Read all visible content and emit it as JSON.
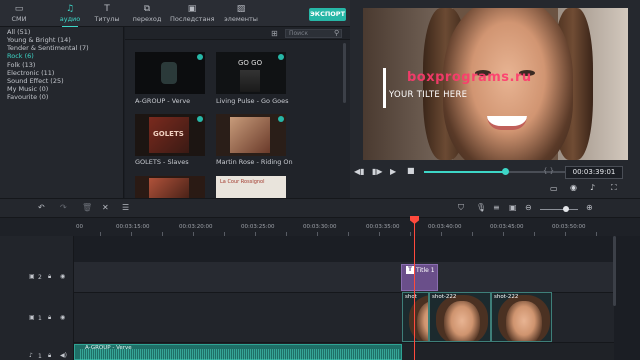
{
  "top_tabs": [
    {
      "label": "СМИ",
      "icon": "folder-icon"
    },
    {
      "label": "аудио",
      "icon": "music-note-icon",
      "active": true
    },
    {
      "label": "Титулы",
      "icon": "text-icon"
    },
    {
      "label": "переход",
      "icon": "transition-icon"
    },
    {
      "label": "Последстаня",
      "icon": "effects-icon"
    },
    {
      "label": "элементы",
      "icon": "image-icon"
    }
  ],
  "export_label": "ЭКСПОРТ",
  "categories": [
    {
      "label": "All (51)"
    },
    {
      "label": "Young & Bright (14)"
    },
    {
      "label": "Tender & Sentimental (7)"
    },
    {
      "label": "Rock (6)",
      "active": true
    },
    {
      "label": "Folk (13)"
    },
    {
      "label": "Electronic (11)"
    },
    {
      "label": "Sound Effect (25)"
    },
    {
      "label": "My Music (0)"
    },
    {
      "label": "Favourite (0)"
    }
  ],
  "search": {
    "placeholder": "Поиск"
  },
  "library": [
    {
      "caption": "A-GROUP - Verve"
    },
    {
      "caption": "Living Pulse - Go Goes"
    },
    {
      "caption": "GOLETS - Slaves"
    },
    {
      "caption": "Martin Rose - Riding On"
    },
    {
      "caption": ""
    },
    {
      "caption": ""
    }
  ],
  "thumb_text": {
    "t2": "GO GO",
    "t3": "GOLETS",
    "t6": "La Cour Rossignol"
  },
  "preview": {
    "title_text": "YOUR TILTE HERE",
    "watermark": "boxprograms.ru",
    "timecode": "00:03:39:01",
    "marker_brackets": "{   }",
    "progress": 0.47
  },
  "ruler": {
    "ticks": [
      "00",
      "00:03:15:00",
      "00:03:20:00",
      "00:03:25:00",
      "00:03:30:00",
      "00:03:35:00",
      "00:03:40:00",
      "00:03:45:00",
      "00:03:50:00"
    ]
  },
  "tracks": [
    {
      "number": "2",
      "clip_label": "Title 1"
    },
    {
      "number": "1",
      "clip_labels": [
        "shot",
        "shot-222",
        "shot-222"
      ]
    },
    {
      "number": "1",
      "clip_label": "A-GROUP - Verve"
    }
  ],
  "colors": {
    "accent": "#3dd6c7",
    "playhead": "#ff4a3d",
    "title_clip": "#6a4f8a",
    "audio_clip": "#1f6f67"
  }
}
